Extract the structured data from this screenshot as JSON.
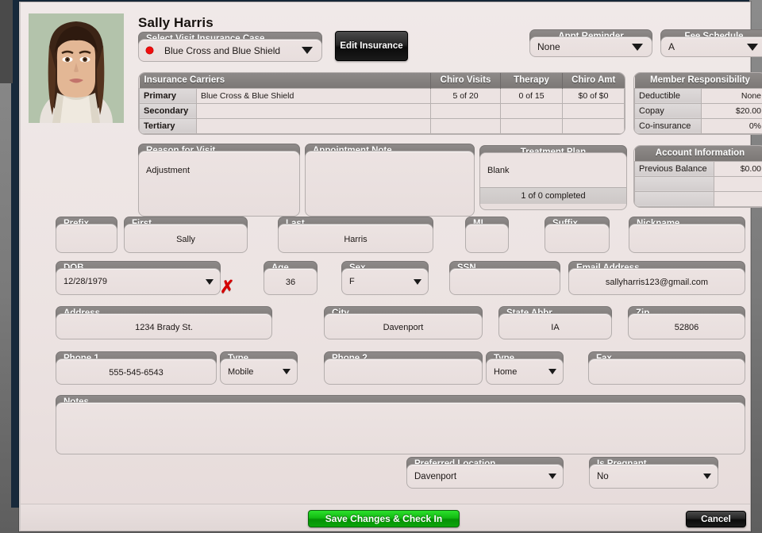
{
  "patient": {
    "name": "Sally Harris",
    "photo_alt": "patient-photo"
  },
  "insurance_case": {
    "label": "Select Visit Insurance Case",
    "value": "Blue Cross and Blue Shield",
    "status_color": "#ef0d0d"
  },
  "edit_insurance_button": "Edit Insurance",
  "appt_reminder": {
    "label": "Appt Reminder",
    "value": "None"
  },
  "fee_schedule": {
    "label": "Fee Schedule",
    "value": "A"
  },
  "carriers_table": {
    "headers": [
      "Insurance Carriers",
      "Chiro Visits",
      "Therapy",
      "Chiro Amt"
    ],
    "rows": [
      {
        "level": "Primary",
        "carrier": "Blue Cross & Blue Shield",
        "chiro_visits": "5 of 20",
        "therapy": "0 of 15",
        "chiro_amt": "$0 of $0"
      },
      {
        "level": "Secondary",
        "carrier": "",
        "chiro_visits": "",
        "therapy": "",
        "chiro_amt": ""
      },
      {
        "level": "Tertiary",
        "carrier": "",
        "chiro_visits": "",
        "therapy": "",
        "chiro_amt": ""
      }
    ]
  },
  "member_responsibility": {
    "title": "Member Responsibility",
    "rows": [
      {
        "label": "Deductible",
        "value": "None"
      },
      {
        "label": "Copay",
        "value": "$20.00"
      },
      {
        "label": "Co-insurance",
        "value": "0%"
      }
    ]
  },
  "reason_for_visit": {
    "label": "Reason for Visit",
    "value": "Adjustment"
  },
  "appointment_note": {
    "label": "Appointment Note",
    "value": ""
  },
  "treatment_plan": {
    "label": "Treatment Plan",
    "value": "Blank",
    "progress": "1 of 0 completed"
  },
  "account_information": {
    "title": "Account Information",
    "rows": [
      {
        "label": "Previous Balance",
        "value": "$0.00"
      },
      {
        "label": "",
        "value": ""
      },
      {
        "label": "",
        "value": ""
      }
    ]
  },
  "name_fields": {
    "prefix": {
      "label": "Prefix",
      "value": ""
    },
    "first": {
      "label": "First",
      "value": "Sally"
    },
    "last": {
      "label": "Last",
      "value": "Harris"
    },
    "mi": {
      "label": "MI",
      "value": ""
    },
    "suffix": {
      "label": "Suffix",
      "value": ""
    },
    "nickname": {
      "label": "Nickname",
      "value": ""
    }
  },
  "demographics": {
    "dob": {
      "label": "DOB",
      "value": "12/28/1979",
      "clear_icon": "red-x-icon"
    },
    "age": {
      "label": "Age",
      "value": "36"
    },
    "sex": {
      "label": "Sex",
      "value": "F"
    },
    "ssn": {
      "label": "SSN",
      "value": ""
    },
    "email": {
      "label": "Email Address",
      "value": "sallyharris123@gmail.com"
    }
  },
  "address_fields": {
    "address": {
      "label": "Address",
      "value": "1234 Brady St."
    },
    "city": {
      "label": "City",
      "value": "Davenport"
    },
    "state": {
      "label": "State Abbr.",
      "value": "IA"
    },
    "zip": {
      "label": "Zip",
      "value": "52806"
    }
  },
  "phone_fields": {
    "phone1": {
      "label": "Phone 1",
      "value": "555-545-6543"
    },
    "type1": {
      "label": "Type",
      "value": "Mobile"
    },
    "phone2": {
      "label": "Phone 2",
      "value": ""
    },
    "type2": {
      "label": "Type",
      "value": "Home"
    },
    "fax": {
      "label": "Fax",
      "value": ""
    }
  },
  "notes": {
    "label": "Notes",
    "value": ""
  },
  "preferred_location": {
    "label": "Preferred Location",
    "value": "Davenport"
  },
  "is_pregnant": {
    "label": "Is Pregnant",
    "value": "No"
  },
  "footer": {
    "save_label": "Save Changes & Check In",
    "cancel_label": "Cancel"
  }
}
